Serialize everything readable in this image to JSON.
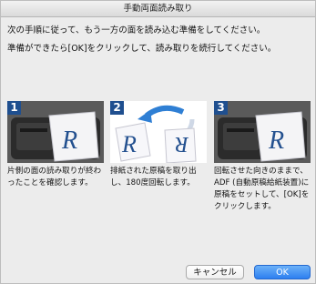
{
  "window": {
    "title": "手動両面読み取り"
  },
  "instructions": {
    "line1": "次の手順に従って、もう一方の面を読み込む準備をしてください。",
    "line2": "準備ができたら[OK]をクリックして、読み取りを続行してください。"
  },
  "steps": [
    {
      "number": "1",
      "text": "片側の面の読み取りが終わったことを確認します。",
      "illustration": "scanner-with-page-icon"
    },
    {
      "number": "2",
      "text": "排紙された原稿を取り出し、180度回転します。",
      "illustration": "rotate-document-icon"
    },
    {
      "number": "3",
      "text": "回転させた向きのままで、ADF (自動原稿給紙装置)に原稿をセットして、[OK]をクリックします。",
      "illustration": "scanner-with-page-icon"
    }
  ],
  "buttons": {
    "cancel": "キャンセル",
    "ok": "OK"
  },
  "page_glyph": "R",
  "colors": {
    "step_badge": "#1f4f8f",
    "ok_button": "#2d7ff0",
    "rotate_arrow": "#2f7fd4"
  }
}
